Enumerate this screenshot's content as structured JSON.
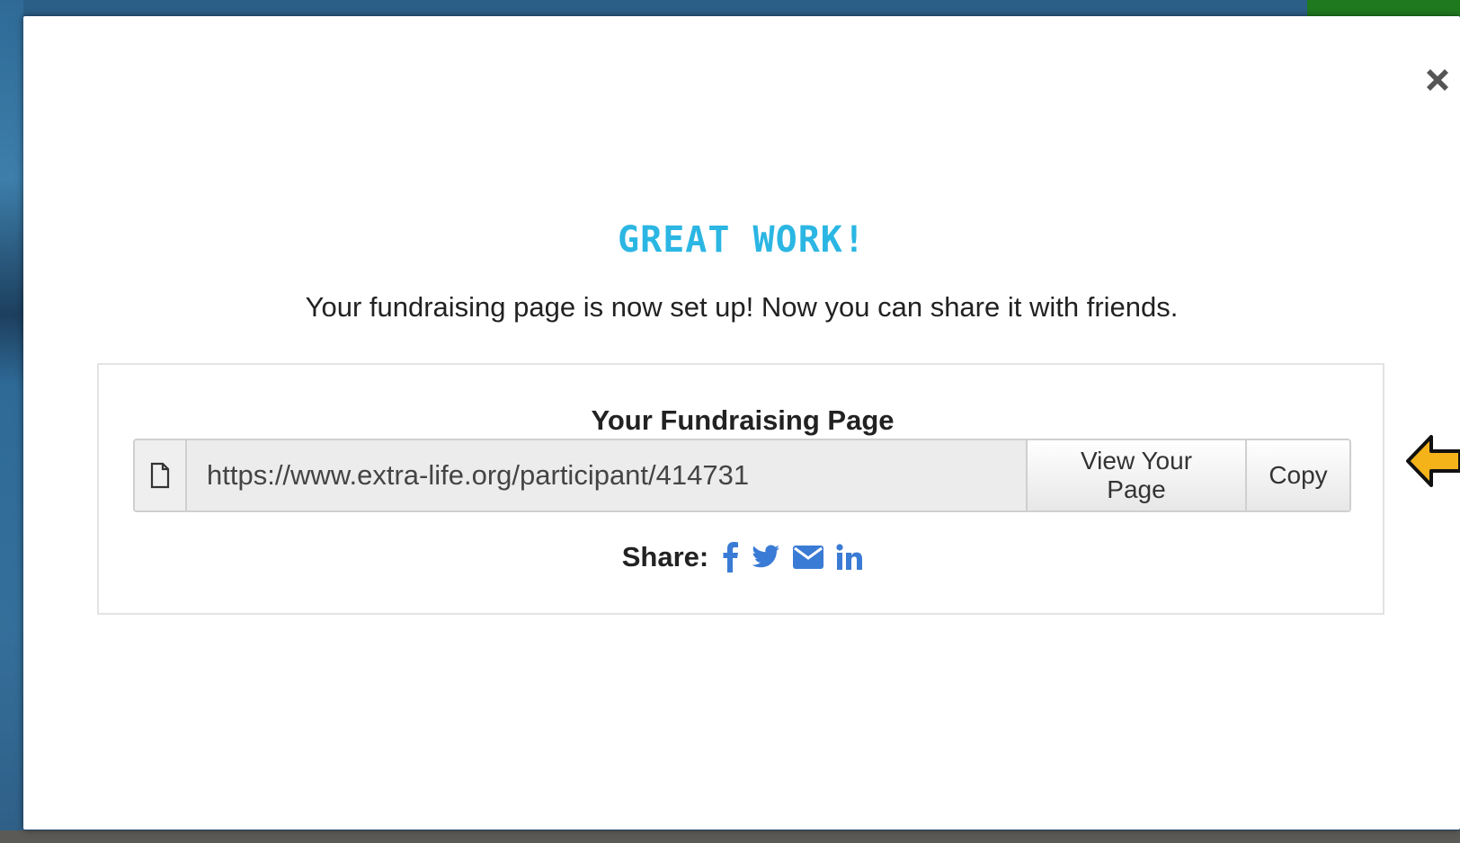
{
  "modal": {
    "headline": "GREAT WORK!",
    "subtext": "Your fundraising page is now set up! Now you can share it with friends.",
    "close_icon": "close-icon",
    "panel": {
      "title": "Your Fundraising Page",
      "url_value": "https://www.extra-life.org/participant/414731",
      "url_icon": "document-icon",
      "view_button_label": "View Your Page",
      "copy_button_label": "Copy",
      "share_label": "Share:",
      "share_icons": [
        "facebook-icon",
        "twitter-icon",
        "email-icon",
        "linkedin-icon"
      ]
    }
  },
  "colors": {
    "headline": "#2bb6e3",
    "share_icons": "#3a7bd5",
    "annotation_arrow": "#f5b31a"
  },
  "annotation": {
    "icon": "left-arrow-icon"
  }
}
